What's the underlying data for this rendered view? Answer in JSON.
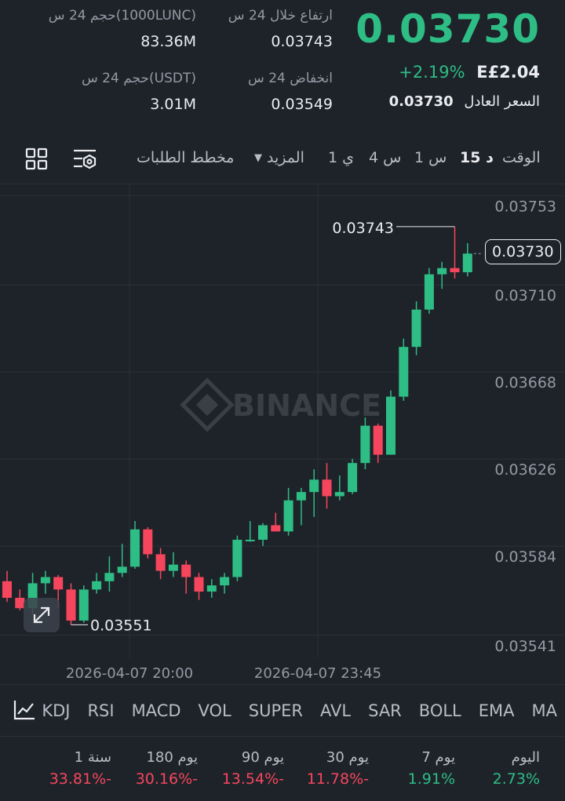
{
  "header": {
    "last_price": "0.03730",
    "change_pct": "+2.19%",
    "local_price": "E£2.04",
    "fair_price_label": "السعر العادل",
    "fair_price_value": "0.03730"
  },
  "stats": {
    "high_label": "ارتفاع خلال 24 س",
    "high_value": "0.03743",
    "low_label": "انخفاض 24 س",
    "low_value": "0.03549",
    "vol_base_label": "حجم 24 س(1000LUNC)",
    "vol_base_value": "83.36M",
    "vol_quote_label": "حجم 24 س(USDT)",
    "vol_quote_value": "3.01M"
  },
  "toolbar": {
    "time_label": "الوقت",
    "tf_15d": "15 د",
    "tf_1h": "1 س",
    "tf_4h": "4 س",
    "tf_1d": "1 ي",
    "more": "المزيد",
    "orderbook_chart": "مخطط الطلبات"
  },
  "chart": {
    "watermark": "BINANCE",
    "current_price": "0.03730",
    "high_marker": "0.03743",
    "low_marker": "0.03551",
    "x_labels": [
      "2026-04-07 20:00",
      "2026-04-07 23:45"
    ],
    "y_ticks": [
      "0.03753",
      "0.03710",
      "0.03668",
      "0.03626",
      "0.03584",
      "0.03541"
    ]
  },
  "chart_data": {
    "type": "candlestick",
    "ylim": [
      0.03536,
      0.03763
    ],
    "y_ticks": [
      0.03753,
      0.0371,
      0.03668,
      0.03626,
      0.03584,
      0.03541
    ],
    "x_ticks": [
      "2026-04-07 20:00",
      "2026-04-07 23:45"
    ],
    "candles": [
      {
        "o": 0.03572,
        "h": 0.03577,
        "l": 0.03562,
        "c": 0.03564
      },
      {
        "o": 0.03564,
        "h": 0.03568,
        "l": 0.03558,
        "c": 0.03559
      },
      {
        "o": 0.03559,
        "h": 0.03576,
        "l": 0.03556,
        "c": 0.03571
      },
      {
        "o": 0.03571,
        "h": 0.03577,
        "l": 0.03566,
        "c": 0.03574
      },
      {
        "o": 0.03574,
        "h": 0.03575,
        "l": 0.03559,
        "c": 0.03568
      },
      {
        "o": 0.03568,
        "h": 0.03571,
        "l": 0.03551,
        "c": 0.03553
      },
      {
        "o": 0.03553,
        "h": 0.0357,
        "l": 0.03552,
        "c": 0.03568
      },
      {
        "o": 0.03568,
        "h": 0.03576,
        "l": 0.03566,
        "c": 0.03572
      },
      {
        "o": 0.03572,
        "h": 0.03584,
        "l": 0.03567,
        "c": 0.03576
      },
      {
        "o": 0.03576,
        "h": 0.0359,
        "l": 0.03574,
        "c": 0.03579
      },
      {
        "o": 0.03579,
        "h": 0.03601,
        "l": 0.03578,
        "c": 0.03597
      },
      {
        "o": 0.03597,
        "h": 0.03598,
        "l": 0.03583,
        "c": 0.03585
      },
      {
        "o": 0.03585,
        "h": 0.03588,
        "l": 0.03573,
        "c": 0.03577
      },
      {
        "o": 0.03577,
        "h": 0.03586,
        "l": 0.03574,
        "c": 0.0358
      },
      {
        "o": 0.0358,
        "h": 0.03582,
        "l": 0.03566,
        "c": 0.03574
      },
      {
        "o": 0.03574,
        "h": 0.03576,
        "l": 0.03563,
        "c": 0.03567
      },
      {
        "o": 0.03567,
        "h": 0.03573,
        "l": 0.03564,
        "c": 0.0357
      },
      {
        "o": 0.0357,
        "h": 0.03576,
        "l": 0.03566,
        "c": 0.03574
      },
      {
        "o": 0.03574,
        "h": 0.03594,
        "l": 0.03572,
        "c": 0.03592
      },
      {
        "o": 0.03592,
        "h": 0.03601,
        "l": 0.03591,
        "c": 0.03592
      },
      {
        "o": 0.03592,
        "h": 0.036,
        "l": 0.03589,
        "c": 0.03599
      },
      {
        "o": 0.03599,
        "h": 0.03605,
        "l": 0.03596,
        "c": 0.03596
      },
      {
        "o": 0.03596,
        "h": 0.03617,
        "l": 0.03594,
        "c": 0.03611
      },
      {
        "o": 0.03611,
        "h": 0.03617,
        "l": 0.03599,
        "c": 0.03615
      },
      {
        "o": 0.03615,
        "h": 0.03626,
        "l": 0.03603,
        "c": 0.03621
      },
      {
        "o": 0.03621,
        "h": 0.03629,
        "l": 0.03607,
        "c": 0.03613
      },
      {
        "o": 0.03613,
        "h": 0.03623,
        "l": 0.03611,
        "c": 0.03615
      },
      {
        "o": 0.03615,
        "h": 0.03631,
        "l": 0.03614,
        "c": 0.03629
      },
      {
        "o": 0.03629,
        "h": 0.03651,
        "l": 0.03626,
        "c": 0.03647
      },
      {
        "o": 0.03647,
        "h": 0.03648,
        "l": 0.03629,
        "c": 0.03633
      },
      {
        "o": 0.03633,
        "h": 0.03664,
        "l": 0.03633,
        "c": 0.03661
      },
      {
        "o": 0.03661,
        "h": 0.03689,
        "l": 0.03659,
        "c": 0.03685
      },
      {
        "o": 0.03685,
        "h": 0.03707,
        "l": 0.03681,
        "c": 0.03703
      },
      {
        "o": 0.03703,
        "h": 0.03723,
        "l": 0.03701,
        "c": 0.0372
      },
      {
        "o": 0.0372,
        "h": 0.03726,
        "l": 0.03713,
        "c": 0.03723
      },
      {
        "o": 0.03723,
        "h": 0.03743,
        "l": 0.03718,
        "c": 0.03721
      },
      {
        "o": 0.03721,
        "h": 0.03735,
        "l": 0.03719,
        "c": 0.0373
      }
    ],
    "current": 0.0373,
    "high_marker": 0.03743,
    "low_marker": 0.03551
  },
  "indicators": [
    "MA",
    "EMA",
    "BOLL",
    "SAR",
    "AVL",
    "SUPER",
    "VOL",
    "MACD",
    "RSI",
    "KDJ"
  ],
  "performance": [
    {
      "label": "اليوم",
      "value": "2.73%",
      "color": "#2ebd85"
    },
    {
      "label": "7 يوم",
      "value": "1.91%",
      "color": "#2ebd85"
    },
    {
      "label": "30 يوم",
      "value": "11.78%-",
      "color": "#f6465d"
    },
    {
      "label": "90 يوم",
      "value": "13.54%-",
      "color": "#f6465d"
    },
    {
      "label": "180 يوم",
      "value": "30.16%-",
      "color": "#f6465d"
    },
    {
      "label": "1 سنة",
      "value": "33.81%-",
      "color": "#f6465d"
    }
  ],
  "colors": {
    "up": "#2ebd85",
    "down": "#f6465d",
    "bg": "#1e2329",
    "grid": "#2b3139"
  },
  "icons": [
    "grid-layout-icon",
    "chart-settings-icon",
    "dropdown-caret-icon",
    "expand-icon",
    "indicator-chart-icon",
    "binance-logo-icon"
  ]
}
